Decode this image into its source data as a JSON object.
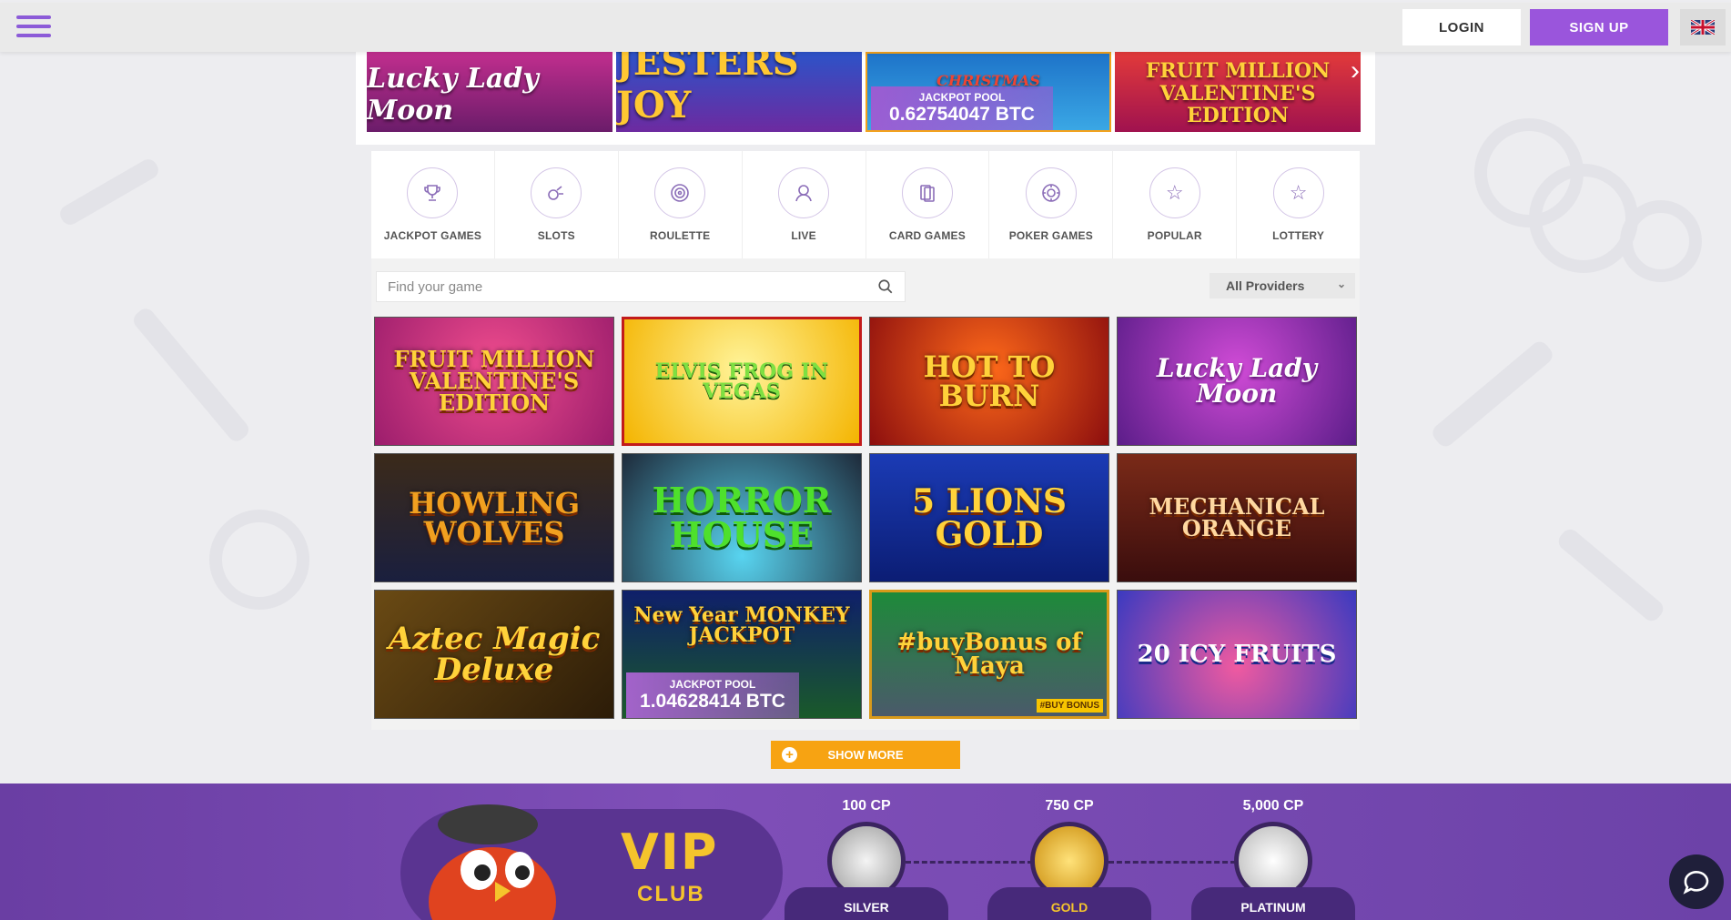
{
  "header": {
    "login_label": "LOGIN",
    "signup_label": "SIGN UP",
    "language_flag": "uk-flag-icon"
  },
  "carousel": {
    "tiles": [
      {
        "title": "Lucky Lady Moon"
      },
      {
        "title": "JESTERS JOY"
      },
      {
        "title": "CHRISTMAS",
        "jackpot_label": "JACKPOT POOL",
        "jackpot_value": "0.62754047 BTC"
      },
      {
        "title": "FRUIT MILLION VALENTINE'S EDITION"
      }
    ]
  },
  "categories": [
    {
      "label": "JACKPOT GAMES",
      "icon": "trophy-icon"
    },
    {
      "label": "SLOTS",
      "icon": "slots-icon"
    },
    {
      "label": "ROULETTE",
      "icon": "roulette-icon"
    },
    {
      "label": "LIVE",
      "icon": "live-dealer-icon"
    },
    {
      "label": "CARD GAMES",
      "icon": "cards-icon"
    },
    {
      "label": "POKER GAMES",
      "icon": "poker-chip-icon"
    },
    {
      "label": "POPULAR",
      "icon": "star-icon"
    },
    {
      "label": "LOTTERY",
      "icon": "star-icon"
    }
  ],
  "search": {
    "placeholder": "Find your game"
  },
  "providers": {
    "selected": "All Providers"
  },
  "games": [
    {
      "title": "FRUIT MILLION VALENTINE'S EDITION"
    },
    {
      "title": "ELVIS FROG IN VEGAS"
    },
    {
      "title": "HOT TO BURN"
    },
    {
      "title": "Lucky Lady Moon"
    },
    {
      "title": "HOWLING WOLVES"
    },
    {
      "title": "HORROR HOUSE"
    },
    {
      "title": "5 LIONS GOLD"
    },
    {
      "title": "MECHANICAL ORANGE"
    },
    {
      "title": "Aztec Magic Deluxe"
    },
    {
      "title": "New Year MONKEY JACKPOT",
      "jackpot_label": "JACKPOT POOL",
      "jackpot_value": "1.04628414 BTC"
    },
    {
      "title": "#buyBonus of Maya",
      "tag": "#BUY BONUS"
    },
    {
      "title": "20 ICY FRUITS"
    }
  ],
  "show_more_label": "SHOW MORE",
  "vip": {
    "vip_word": "VIP",
    "club_word": "CLUB",
    "tiers": [
      {
        "cp": "100 CP",
        "name": "SILVER"
      },
      {
        "cp": "750 CP",
        "name": "GOLD"
      },
      {
        "cp": "5,000 CP",
        "name": "PLATINUM"
      }
    ]
  },
  "colors": {
    "accent": "#9a55dc",
    "show_more": "#f7a312",
    "vip_bg": "#7f4fb8",
    "vip_gold": "#f5c42c"
  }
}
